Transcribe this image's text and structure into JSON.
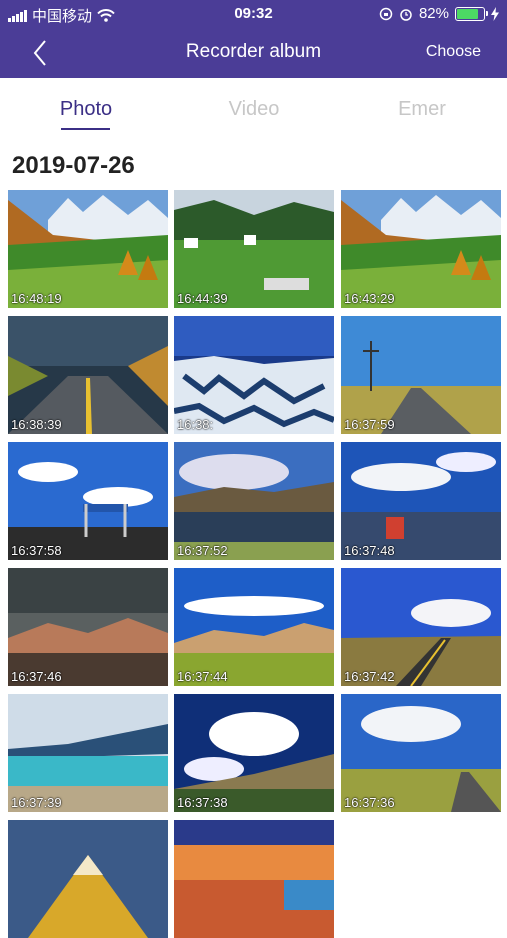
{
  "status_bar": {
    "carrier": "中国移动",
    "time": "09:32",
    "battery": "82%",
    "battery_level": 0.82,
    "battery_color": "#4cd964"
  },
  "nav": {
    "title": "Recorder album",
    "choose_label": "Choose",
    "back_icon": "chevron-left-icon"
  },
  "tabs": [
    {
      "label": "Photo",
      "active": true
    },
    {
      "label": "Video",
      "active": false
    },
    {
      "label": "Emer",
      "active": false
    }
  ],
  "colors": {
    "header": "#4b3d97",
    "accent": "#3b2f86"
  },
  "section_date": "2019-07-26",
  "photos": [
    {
      "time": "16:48:19",
      "scene": "alpine-meadow"
    },
    {
      "time": "16:44:39",
      "scene": "green-village"
    },
    {
      "time": "16:43:29",
      "scene": "alpine-meadow"
    },
    {
      "time": "16:38:39",
      "scene": "storm-road"
    },
    {
      "time": "16:38:",
      "scene": "snow-mountains-aerial"
    },
    {
      "time": "16:37:59",
      "scene": "highway-pylon"
    },
    {
      "time": "16:37:58",
      "scene": "sign-gantry"
    },
    {
      "time": "16:37:52",
      "scene": "lake-clouds"
    },
    {
      "time": "16:37:48",
      "scene": "lake-shore"
    },
    {
      "time": "16:37:46",
      "scene": "dark-hills"
    },
    {
      "time": "16:37:44",
      "scene": "grassland-dunes"
    },
    {
      "time": "16:37:42",
      "scene": "road-curve"
    },
    {
      "time": "16:37:39",
      "scene": "turquoise-lake"
    },
    {
      "time": "16:37:38",
      "scene": "cloud-road"
    },
    {
      "time": "16:37:36",
      "scene": "plain-road"
    },
    {
      "time": "",
      "scene": "golden-peak"
    },
    {
      "time": "",
      "scene": "sunset-desert"
    }
  ]
}
